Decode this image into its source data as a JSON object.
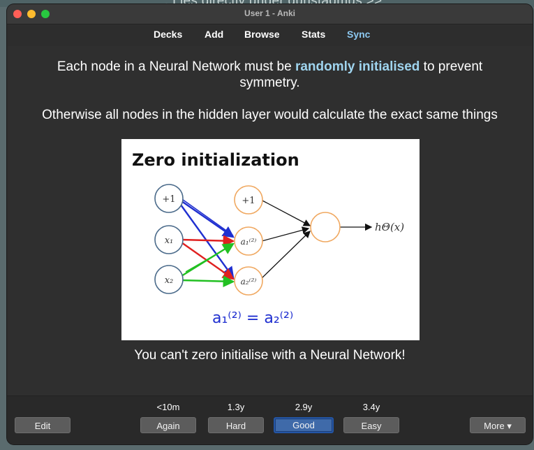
{
  "background_text": "'. Lies directly under gunstadmus >>",
  "window": {
    "title": "User 1 - Anki"
  },
  "toolbar": {
    "decks": "Decks",
    "add": "Add",
    "browse": "Browse",
    "stats": "Stats",
    "sync": "Sync",
    "sync_color": "#8cc8f0"
  },
  "card": {
    "line1_before": "Each node in a Neural Network must be ",
    "line1_highlight": "randomly initialised",
    "line1_after": " to prevent symmetry.",
    "line2": "Otherwise all nodes in the hidden layer would calculate the exact same things",
    "image": {
      "title": "Zero initialization",
      "input_nodes": [
        "+1",
        "x₁",
        "x₂"
      ],
      "hidden_nodes": [
        "+1",
        "a₁⁽²⁾",
        "a₂⁽²⁾"
      ],
      "output_label": "hΘ(x)",
      "handwriting": "a₁⁽²⁾ = a₂⁽²⁾"
    },
    "caption": "You can't zero initialise with a Neural Network!"
  },
  "answer_buttons": [
    {
      "interval": "<10m",
      "label": "Again"
    },
    {
      "interval": "1.3y",
      "label": "Hard"
    },
    {
      "interval": "2.9y",
      "label": "Good"
    },
    {
      "interval": "3.4y",
      "label": "Easy"
    }
  ],
  "edit_label": "Edit",
  "more_label": "More ▾"
}
